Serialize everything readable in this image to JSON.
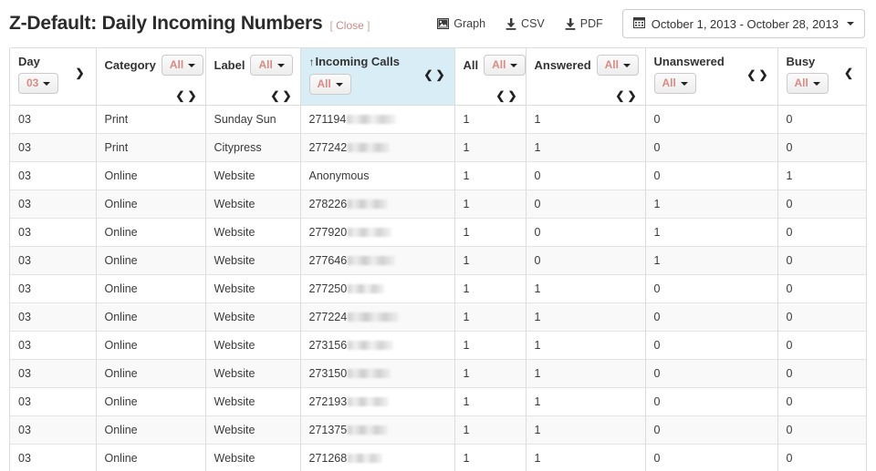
{
  "header": {
    "title": "Z-Default: Daily Incoming Numbers",
    "close_label": "Close",
    "bracket_open": "[",
    "bracket_close": "]",
    "actions": [
      {
        "label": "Graph",
        "icon": "image-icon"
      },
      {
        "label": "CSV",
        "icon": "download-icon"
      },
      {
        "label": "PDF",
        "icon": "download-icon"
      }
    ],
    "daterange": {
      "icon": "calendar-icon",
      "label": "October 1, 2013 - October 28, 2013",
      "caret": "caret-down-icon"
    }
  },
  "colors": {
    "accent_red": "#d98b84",
    "highlight_blue": "#d9edf7",
    "border": "#dddddd",
    "stripe": "#f9f9f9"
  },
  "table": {
    "columns": [
      {
        "title": "Day",
        "filter": "03",
        "sorted": false,
        "arrows": "right",
        "highlight": false
      },
      {
        "title": "Category",
        "filter": "All",
        "sorted": false,
        "arrows": "both",
        "highlight": false
      },
      {
        "title": "Label",
        "filter": "All",
        "sorted": false,
        "arrows": "both",
        "highlight": false
      },
      {
        "title": "Incoming Calls",
        "filter": "All",
        "sorted": true,
        "arrows": "both",
        "highlight": true
      },
      {
        "title": "All",
        "filter": "All",
        "sorted": false,
        "arrows": "both",
        "highlight": false
      },
      {
        "title": "Answered",
        "filter": "All",
        "sorted": false,
        "arrows": "both",
        "highlight": false
      },
      {
        "title": "Unanswered",
        "filter": "All",
        "sorted": false,
        "arrows": "both",
        "highlight": false
      },
      {
        "title": "Busy",
        "filter": "All",
        "sorted": false,
        "arrows": "left",
        "highlight": false
      }
    ],
    "sort_arrow_glyph": "↑",
    "arrow_left_glyph": "❮",
    "arrow_right_glyph": "❯",
    "rows": [
      {
        "day": "03",
        "category": "Print",
        "label": "Sunday Sun",
        "number": "271194",
        "redacted": true,
        "all": "1",
        "answered": "1",
        "unanswered": "0",
        "busy": "0"
      },
      {
        "day": "03",
        "category": "Print",
        "label": "Citypress",
        "number": "277242",
        "redacted": true,
        "all": "1",
        "answered": "1",
        "unanswered": "0",
        "busy": "0"
      },
      {
        "day": "03",
        "category": "Online",
        "label": "Website",
        "number": "Anonymous",
        "redacted": false,
        "all": "1",
        "answered": "0",
        "unanswered": "0",
        "busy": "1"
      },
      {
        "day": "03",
        "category": "Online",
        "label": "Website",
        "number": "278226",
        "redacted": true,
        "all": "1",
        "answered": "0",
        "unanswered": "1",
        "busy": "0"
      },
      {
        "day": "03",
        "category": "Online",
        "label": "Website",
        "number": "277920",
        "redacted": true,
        "all": "1",
        "answered": "0",
        "unanswered": "1",
        "busy": "0"
      },
      {
        "day": "03",
        "category": "Online",
        "label": "Website",
        "number": "277646",
        "redacted": true,
        "all": "1",
        "answered": "0",
        "unanswered": "1",
        "busy": "0"
      },
      {
        "day": "03",
        "category": "Online",
        "label": "Website",
        "number": "277250",
        "redacted": true,
        "all": "1",
        "answered": "1",
        "unanswered": "0",
        "busy": "0"
      },
      {
        "day": "03",
        "category": "Online",
        "label": "Website",
        "number": "277224",
        "redacted": true,
        "all": "1",
        "answered": "1",
        "unanswered": "0",
        "busy": "0"
      },
      {
        "day": "03",
        "category": "Online",
        "label": "Website",
        "number": "273156",
        "redacted": true,
        "all": "1",
        "answered": "1",
        "unanswered": "0",
        "busy": "0"
      },
      {
        "day": "03",
        "category": "Online",
        "label": "Website",
        "number": "273150",
        "redacted": true,
        "all": "1",
        "answered": "1",
        "unanswered": "0",
        "busy": "0"
      },
      {
        "day": "03",
        "category": "Online",
        "label": "Website",
        "number": "272193",
        "redacted": true,
        "all": "1",
        "answered": "1",
        "unanswered": "0",
        "busy": "0"
      },
      {
        "day": "03",
        "category": "Online",
        "label": "Website",
        "number": "271375",
        "redacted": true,
        "all": "1",
        "answered": "1",
        "unanswered": "0",
        "busy": "0"
      },
      {
        "day": "03",
        "category": "Online",
        "label": "Website",
        "number": "271268",
        "redacted": true,
        "all": "1",
        "answered": "1",
        "unanswered": "0",
        "busy": "0"
      }
    ]
  }
}
